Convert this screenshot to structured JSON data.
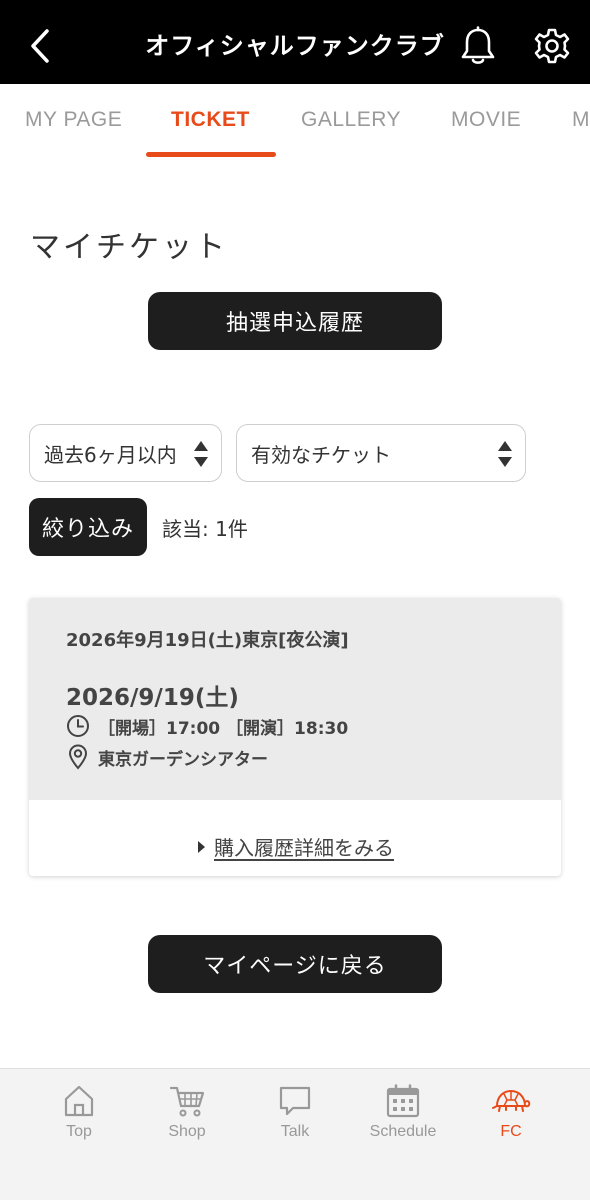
{
  "header": {
    "title": "オフィシャルファンクラブ"
  },
  "tabs": [
    {
      "label": "MY PAGE",
      "active": false
    },
    {
      "label": "TICKET",
      "active": true
    },
    {
      "label": "GALLERY",
      "active": false
    },
    {
      "label": "MOVIE",
      "active": false
    },
    {
      "label": "M",
      "active": false
    }
  ],
  "main": {
    "title": "マイチケット",
    "lottery_button": "抽選申込履歴",
    "filters": {
      "period_value": "過去6ヶ月以内",
      "status_value": "有効なチケット",
      "filter_button": "絞り込み",
      "result_count": "該当: 1件"
    },
    "ticket": {
      "title": "2026年9月19日(土)東京[夜公演]",
      "date": "2026/9/19(土)",
      "times": "［開場］17:00 ［開演］18:30",
      "venue": "東京ガーデンシアター",
      "detail_link": "購入履歴詳細をみる"
    },
    "back_button": "マイページに戻る"
  },
  "bottom_nav": [
    {
      "label": "Top",
      "icon": "home-icon"
    },
    {
      "label": "Shop",
      "icon": "cart-icon"
    },
    {
      "label": "Talk",
      "icon": "chat-icon"
    },
    {
      "label": "Schedule",
      "icon": "calendar-icon"
    },
    {
      "label": "FC",
      "icon": "turtle-icon",
      "active": true
    }
  ],
  "colors": {
    "accent": "#e84b1a",
    "header_bg": "#000000",
    "button_bg": "#1e1e1e",
    "card_bg": "#ebebeb"
  }
}
